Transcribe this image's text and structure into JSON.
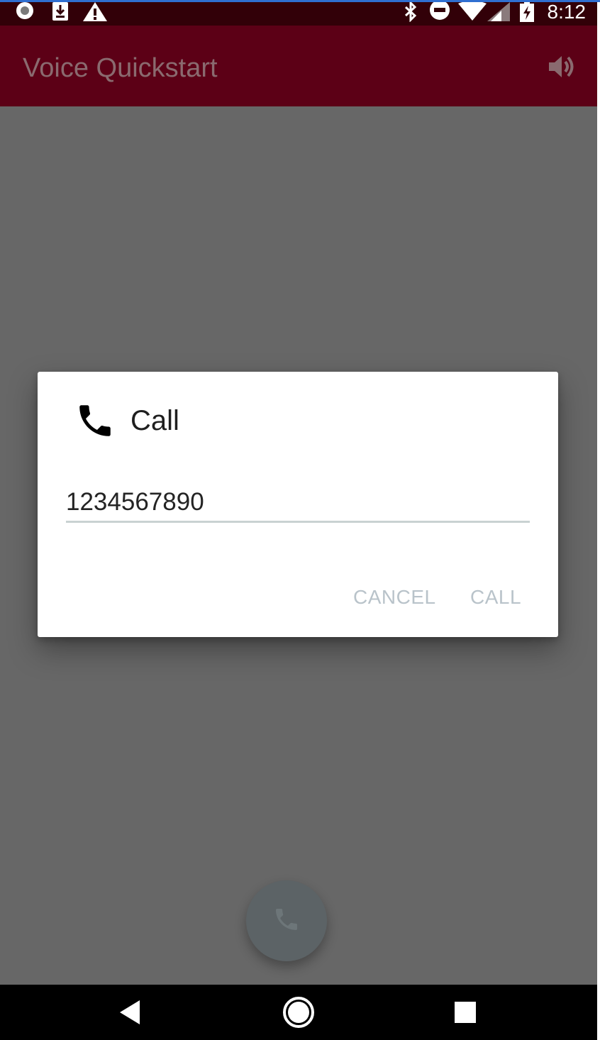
{
  "status_bar": {
    "time": "8:12",
    "icons": [
      "record-icon",
      "download-icon",
      "warning-icon",
      "bluetooth-icon",
      "do-not-disturb-icon",
      "wifi-icon",
      "cellular-signal-icon",
      "battery-charging-icon"
    ]
  },
  "app_bar": {
    "title": "Voice Quickstart",
    "action_icon": "volume-icon"
  },
  "dialog": {
    "icon": "phone-icon",
    "title": "Call",
    "input": {
      "value": "1234567890"
    },
    "cancel_label": "CANCEL",
    "call_label": "CALL"
  },
  "fab": {
    "icon": "phone-icon"
  },
  "nav_bar": {
    "icons": [
      "back-icon",
      "home-icon",
      "recents-icon"
    ]
  },
  "colors": {
    "status_bar": "#320008",
    "app_bar": "#5c0016",
    "scrim_background": "#676767",
    "dialog_button_text": "#b9c3ca",
    "input_underline": "#c9d2d2",
    "fab": "#5c6366"
  }
}
